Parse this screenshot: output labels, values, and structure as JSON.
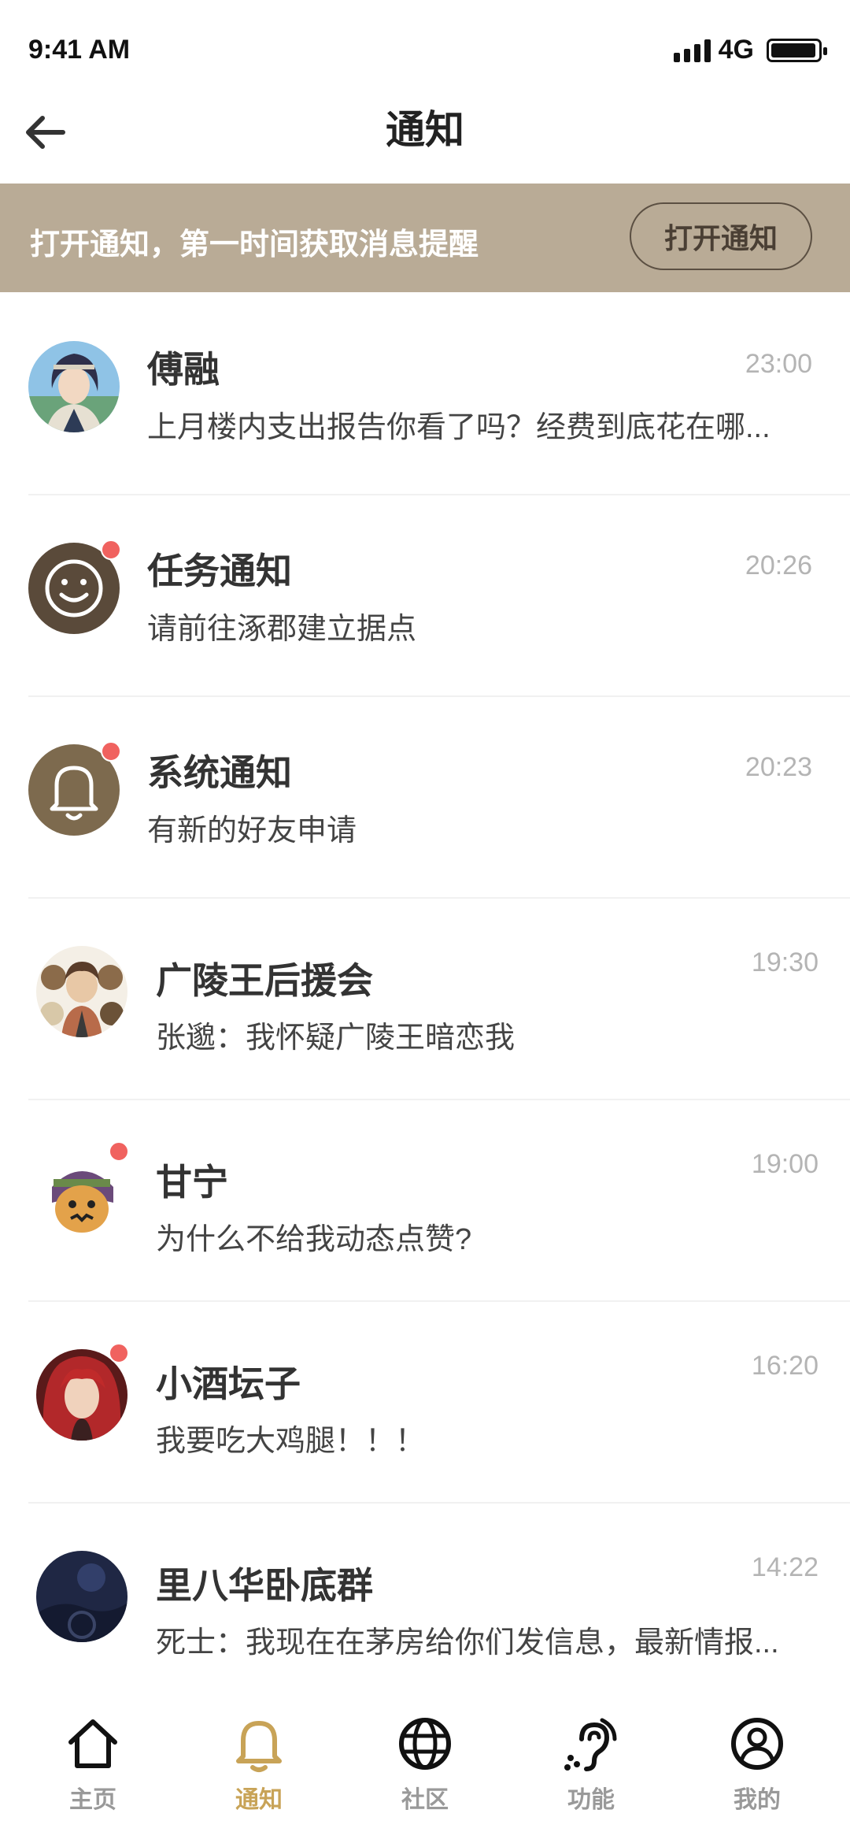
{
  "status_bar": {
    "time": "9:41 AM",
    "network": "4G"
  },
  "header": {
    "title": "通知"
  },
  "banner": {
    "text": "打开通知，第一时间获取消息提醒",
    "button_label": "打开通知"
  },
  "notifications": [
    {
      "name": "傅融",
      "message": "上月楼内支出报告你看了吗？经费到底花在哪...",
      "time": "23:00",
      "unread": false
    },
    {
      "name": "任务通知",
      "message": "请前往涿郡建立据点",
      "time": "20:26",
      "unread": true
    },
    {
      "name": "系统通知",
      "message": "有新的好友申请",
      "time": "20:23",
      "unread": true
    },
    {
      "name": "广陵王后援会",
      "message": "张邈：我怀疑广陵王暗恋我",
      "time": "19:30",
      "unread": false
    },
    {
      "name": "甘宁",
      "message": "为什么不给我动态点赞?",
      "time": "19:00",
      "unread": true
    },
    {
      "name": "小酒坛子",
      "message": "我要吃大鸡腿！！！",
      "time": "16:20",
      "unread": true
    },
    {
      "name": "里八华卧底群",
      "message": "死士：我现在在茅房给你们发信息，最新情报...",
      "time": "14:22",
      "unread": false
    }
  ],
  "tabbar": {
    "active": "通知",
    "tabs": [
      {
        "label": "主页",
        "icon": "home-icon"
      },
      {
        "label": "通知",
        "icon": "bell-icon"
      },
      {
        "label": "社区",
        "icon": "globe-icon"
      },
      {
        "label": "功能",
        "icon": "hearing-icon"
      },
      {
        "label": "我的",
        "icon": "user-icon"
      }
    ]
  },
  "colors": {
    "banner_bg": "#b9ab96",
    "accent": "#c8a357",
    "unread_dot": "#f0625f",
    "icon_brown": "#5a4a3a"
  }
}
